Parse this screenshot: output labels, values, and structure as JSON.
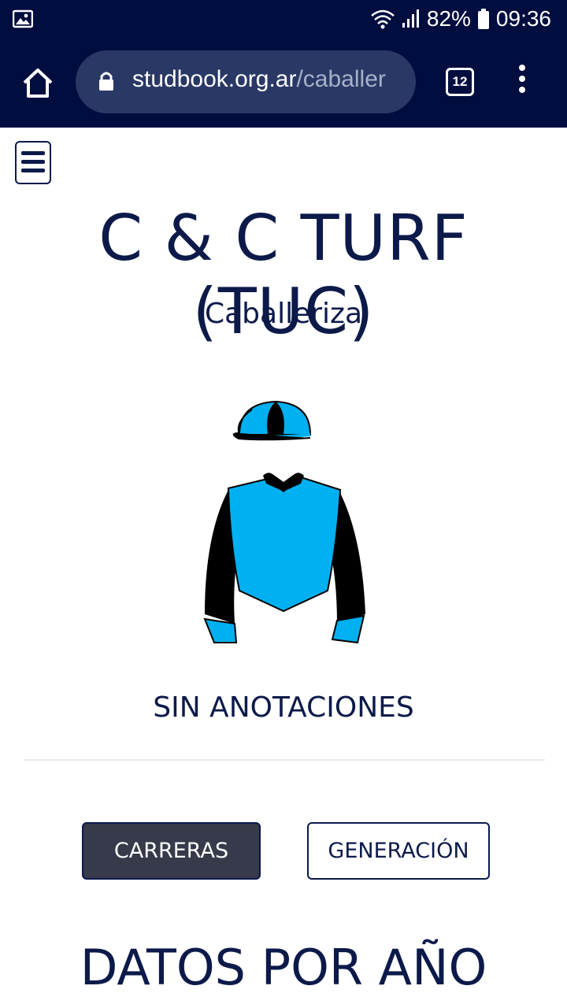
{
  "status_bar": {
    "left_icon": "image-notification-icon",
    "battery_percent": "82%",
    "time": "09:36",
    "icons": [
      "wifi-icon",
      "signal-icon",
      "battery-icon"
    ]
  },
  "browser": {
    "url_host": "studbook.org.ar",
    "url_path": "/caballer",
    "tab_count": "12"
  },
  "page": {
    "title": "C & C TURF (TUC)",
    "subtitle": "Caballeriza",
    "annotation": "SIN ANOTACIONES",
    "buttons": {
      "carreras": "CARRERAS",
      "generacion": "GENERACIÓN"
    },
    "section_title": "DATOS POR AÑO"
  },
  "silks": {
    "body_color": "#00b0f0",
    "sleeve_color": "#000000",
    "cuff_color": "#00b0f0",
    "cap_colors": [
      "#00b0f0",
      "#000000"
    ]
  },
  "colors": {
    "status_bar_bg": "#000d3f",
    "text_navy": "#0c1a4a",
    "primary_button_bg": "#363a4a"
  }
}
